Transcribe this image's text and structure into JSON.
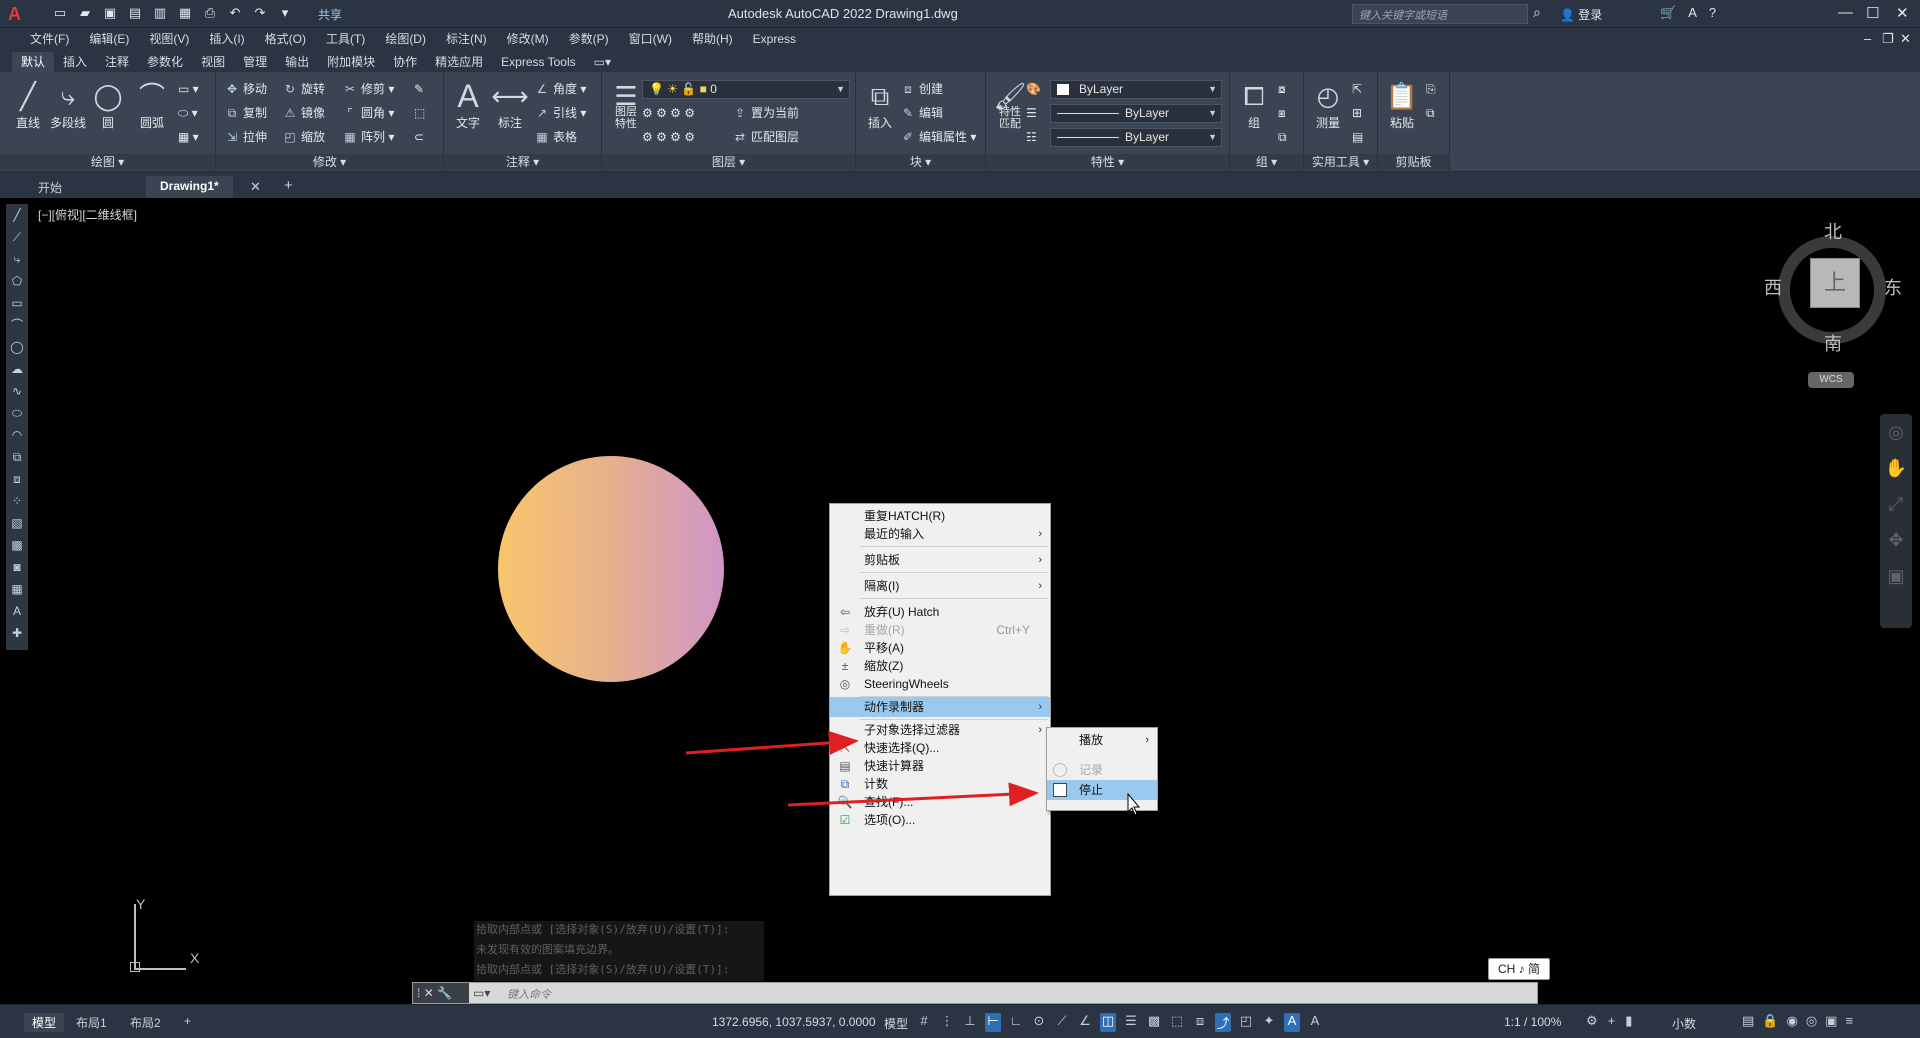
{
  "titlebar": {
    "logo": "A",
    "share": "共享",
    "title": "Autodesk AutoCAD 2022    Drawing1.dwg",
    "search_placeholder": "键入关键字或短语",
    "login": "登录"
  },
  "menubar": {
    "items": [
      "文件(F)",
      "编辑(E)",
      "视图(V)",
      "插入(I)",
      "格式(O)",
      "工具(T)",
      "绘图(D)",
      "标注(N)",
      "修改(M)",
      "参数(P)",
      "窗口(W)",
      "帮助(H)",
      "Express"
    ]
  },
  "ribbon_tabs": [
    "默认",
    "插入",
    "注释",
    "参数化",
    "视图",
    "管理",
    "输出",
    "附加模块",
    "协作",
    "精选应用",
    "Express Tools"
  ],
  "ribbon": {
    "draw": {
      "title": "绘图",
      "tools": [
        "直线",
        "多段线",
        "圆",
        "圆弧"
      ]
    },
    "modify": {
      "title": "修改",
      "tools": [
        "移动",
        "旋转",
        "修剪",
        "复制",
        "镜像",
        "圆角",
        "拉伸",
        "缩放",
        "阵列"
      ]
    },
    "annotation": {
      "title": "注释",
      "tools": [
        "文字",
        "标注",
        "角度",
        "引线",
        "表格"
      ]
    },
    "layers": {
      "title": "图层",
      "big": "图层\n特性",
      "layer_value": "0",
      "tools": [
        "置为当前",
        "匹配图层"
      ]
    },
    "block": {
      "title": "块",
      "big": "插入",
      "tools": [
        "创建",
        "编辑",
        "编辑属性"
      ]
    },
    "properties": {
      "title": "特性",
      "big": "特性\n匹配",
      "color": "ByLayer",
      "linetype": "ByLayer",
      "lineweight": "ByLayer"
    },
    "groups": {
      "title": "组",
      "big": "组"
    },
    "utilities": {
      "title": "实用工具",
      "big": "测量"
    },
    "clipboard": {
      "title": "剪贴板",
      "big": "粘贴"
    }
  },
  "doctabs": {
    "start": "开始",
    "drawing": "Drawing1*"
  },
  "viewport": {
    "label": "[−][俯视][二维线框]",
    "compass": {
      "n": "北",
      "s": "南",
      "e": "东",
      "w": "西",
      "face": "上"
    },
    "wcs": "WCS",
    "ucs_x": "X",
    "ucs_y": "Y"
  },
  "command": {
    "history": [
      "拾取内部点或 [选择对象(S)/放弃(U)/设置(T)]:",
      "未发现有效的图案填充边界。",
      "拾取内部点或 [选择对象(S)/放弃(U)/设置(T)]:"
    ],
    "placeholder": "键入命令"
  },
  "ime": "CH ♪ 简",
  "context_menu": {
    "items": [
      {
        "label": "重复HATCH(R)"
      },
      {
        "label": "最近的输入"
      },
      {
        "label": "剪贴板"
      },
      {
        "label": "隔离(I)"
      },
      {
        "label": "放弃(U) Hatch"
      },
      {
        "label": "重做(R)",
        "shortcut": "Ctrl+Y"
      },
      {
        "label": "平移(A)"
      },
      {
        "label": "缩放(Z)"
      },
      {
        "label": "SteeringWheels"
      },
      {
        "label": "动作录制器"
      },
      {
        "label": "子对象选择过滤器"
      },
      {
        "label": "快速选择(Q)..."
      },
      {
        "label": "快速计算器"
      },
      {
        "label": "计数"
      },
      {
        "label": "查找(F)..."
      },
      {
        "label": "选项(O)..."
      }
    ]
  },
  "submenu": {
    "items": [
      {
        "label": "播放"
      },
      {
        "label": "记录"
      },
      {
        "label": "停止"
      }
    ]
  },
  "statusbar": {
    "layouts": [
      "模型",
      "布局1",
      "布局2"
    ],
    "coords": "1372.6956, 1037.5937, 0.0000",
    "model": "模型",
    "scale": "1:1 / 100%",
    "units": "小数"
  },
  "colors": {
    "accent": "#2f6fb4",
    "highlight": "#99c9ef",
    "arrow": "#e02020",
    "circle_start": "#f9c56b",
    "circle_end": "#cf95c7"
  }
}
